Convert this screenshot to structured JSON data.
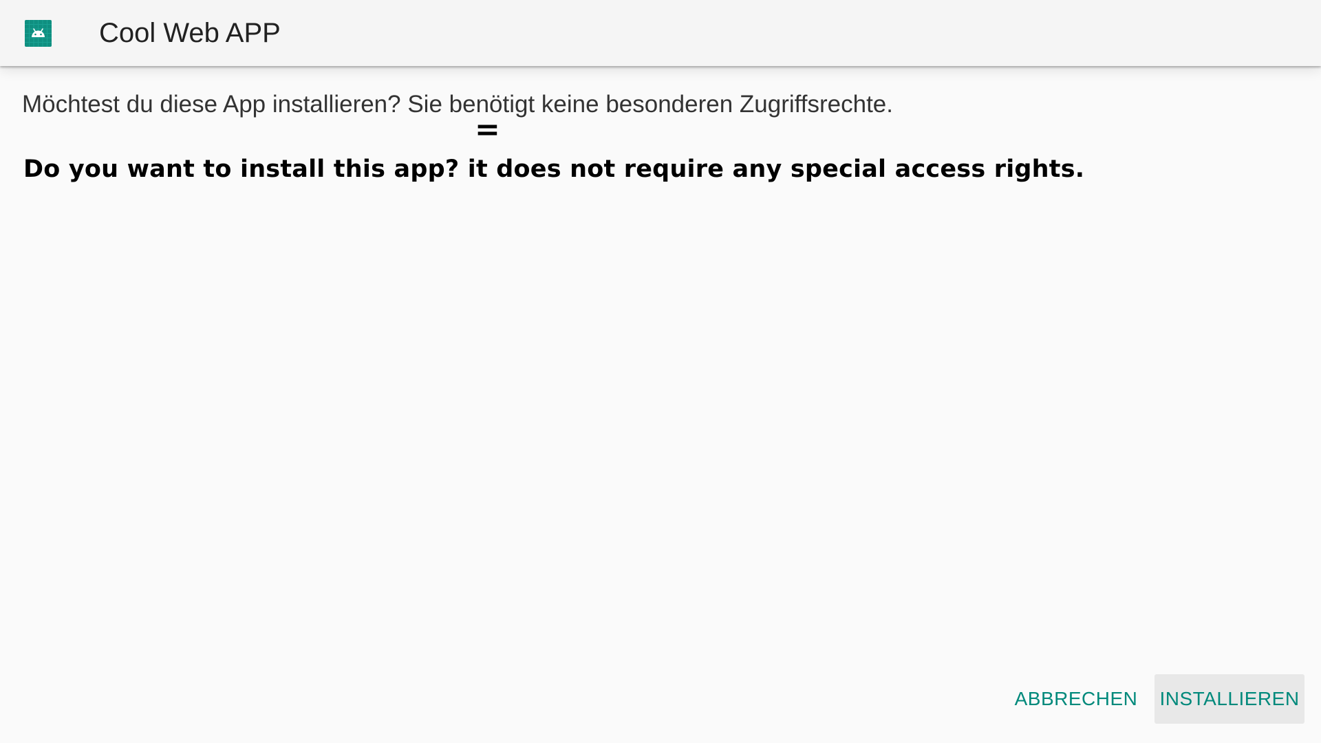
{
  "app_bar": {
    "icon": "android-icon",
    "title": "Cool Web APP"
  },
  "dialog": {
    "message": "Möchtest du diese App installieren? Sie benötigt keine besonderen Zugriffsrechte.",
    "equals": "=",
    "translation": "Do you want to install this app? it does not require any special access rights."
  },
  "buttons": {
    "cancel_label": "ABBRECHEN",
    "install_label": "INSTALLIEREN"
  },
  "colors": {
    "accent": "#00897b",
    "app_bar_bg": "#f5f5f5",
    "background": "#fafafa",
    "focused_button_bg": "#e8e8e8"
  }
}
